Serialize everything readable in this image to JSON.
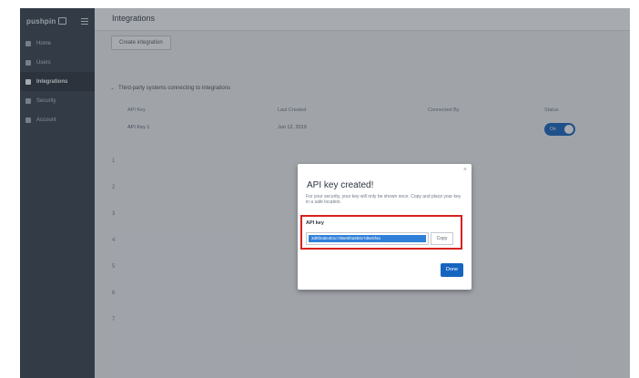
{
  "brand": {
    "name": "pushpin",
    "logo_icon": "box-logo-icon"
  },
  "sidebar": {
    "items": [
      {
        "label": "Home",
        "icon": "home-icon",
        "active": false
      },
      {
        "label": "Users",
        "icon": "users-icon",
        "active": false
      },
      {
        "label": "Integrations",
        "icon": "integrations-icon",
        "active": true
      },
      {
        "label": "Security",
        "icon": "security-icon",
        "active": false
      },
      {
        "label": "Account",
        "icon": "account-icon",
        "active": false
      }
    ]
  },
  "header": {
    "title": "Integrations"
  },
  "main": {
    "create_button": "Create integration",
    "section_title": "Third-party systems connecting to Integrations",
    "columns": [
      "API Key",
      "Last Created",
      "Connected By",
      "Status"
    ],
    "row": {
      "api_key": "API Key 1",
      "last_created": "Jun 12, 2019",
      "status": "On"
    },
    "row_numbers": [
      "1",
      "2",
      "3",
      "4",
      "5",
      "6",
      "7"
    ]
  },
  "modal": {
    "title": "API key created!",
    "message": "For your security, your key will only be shown once. Copy and place your key in a safe location.",
    "key_label": "API key",
    "key_value": "3d9f2a8e4b1c7d6e5f0a9b8c7d6e5f4a",
    "copy_label": "Copy",
    "done_label": "Done",
    "close_glyph": "×"
  },
  "colors": {
    "accent": "#1565c0",
    "sidebar": "#37404c",
    "highlight": "#d82020"
  }
}
